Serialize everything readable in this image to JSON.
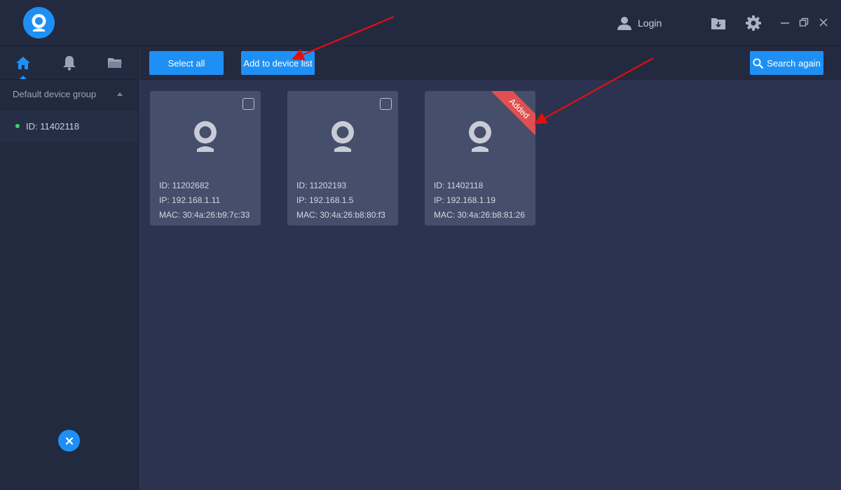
{
  "header": {
    "login_label": "Login"
  },
  "sidebar": {
    "nav": [
      {
        "icon": "home-icon",
        "active": true
      },
      {
        "icon": "bell-icon",
        "active": false
      },
      {
        "icon": "folder-icon",
        "active": false
      }
    ],
    "group_label": "Default device group",
    "devices": [
      {
        "label": "ID: 11402118",
        "status_color": "#39d36e"
      }
    ]
  },
  "toolbar": {
    "select_all_label": "Select all",
    "add_label": "Add to device list",
    "search_label": "Search again"
  },
  "devices": [
    {
      "id": "ID: 11202682",
      "ip": "IP: 192.168.1.11",
      "mac": "MAC: 30:4a:26:b9:7c:33",
      "added": false
    },
    {
      "id": "ID: 11202193",
      "ip": "IP: 192.168.1.5",
      "mac": "MAC: 30:4a:26:b8:80:f3",
      "added": false
    },
    {
      "id": "ID: 11402118",
      "ip": "IP: 192.168.1.19",
      "mac": "MAC: 30:4a:26:b8:81:26",
      "added": true,
      "badge": "Added"
    }
  ],
  "colors": {
    "accent": "#1e90f5",
    "badge": "#e05050",
    "annotation": "#e01010"
  }
}
